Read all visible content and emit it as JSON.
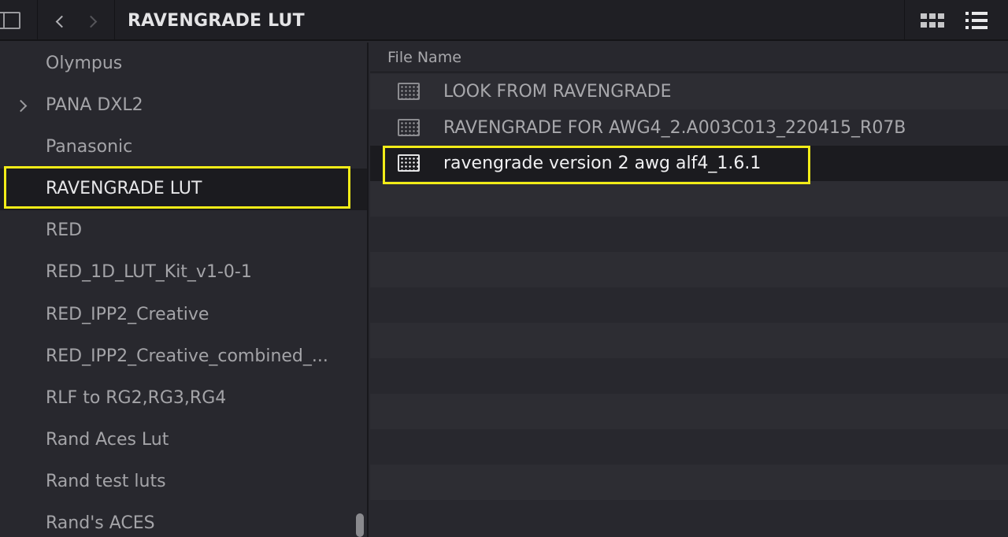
{
  "toolbar": {
    "title": "RAVENGRADE LUT",
    "icons": [
      "sidebar-toggle-icon",
      "chevron-left-icon",
      "chevron-right-icon",
      "grid-view-icon",
      "list-view-icon"
    ]
  },
  "sidebar": {
    "items": [
      {
        "label": "Olympus"
      },
      {
        "label": "PANA DXL2",
        "expandable": true
      },
      {
        "label": "Panasonic"
      },
      {
        "label": "RAVENGRADE LUT",
        "selected": true
      },
      {
        "label": "RED"
      },
      {
        "label": "RED_1D_LUT_Kit_v1-0-1"
      },
      {
        "label": "RED_IPP2_Creative"
      },
      {
        "label": "RED_IPP2_Creative_combined_..."
      },
      {
        "label": "RLF to RG2,RG3,RG4"
      },
      {
        "label": "Rand Aces Lut"
      },
      {
        "label": "Rand test luts"
      },
      {
        "label": "Rand's ACES"
      }
    ]
  },
  "filepane": {
    "column_header": "File Name",
    "files": [
      {
        "name": "LOOK FROM RAVENGRADE",
        "icon": "lut-file-icon"
      },
      {
        "name": "RAVENGRADE FOR AWG4_2.A003C013_220415_R07B",
        "icon": "lut-file-icon"
      },
      {
        "name": "ravengrade version 2 awg alf4_1.6.1",
        "icon": "lut-file-icon",
        "selected": true
      }
    ]
  },
  "colors": {
    "highlight": "#f2ec18",
    "background": "#28282e",
    "selected_row": "#1b1b1f"
  }
}
